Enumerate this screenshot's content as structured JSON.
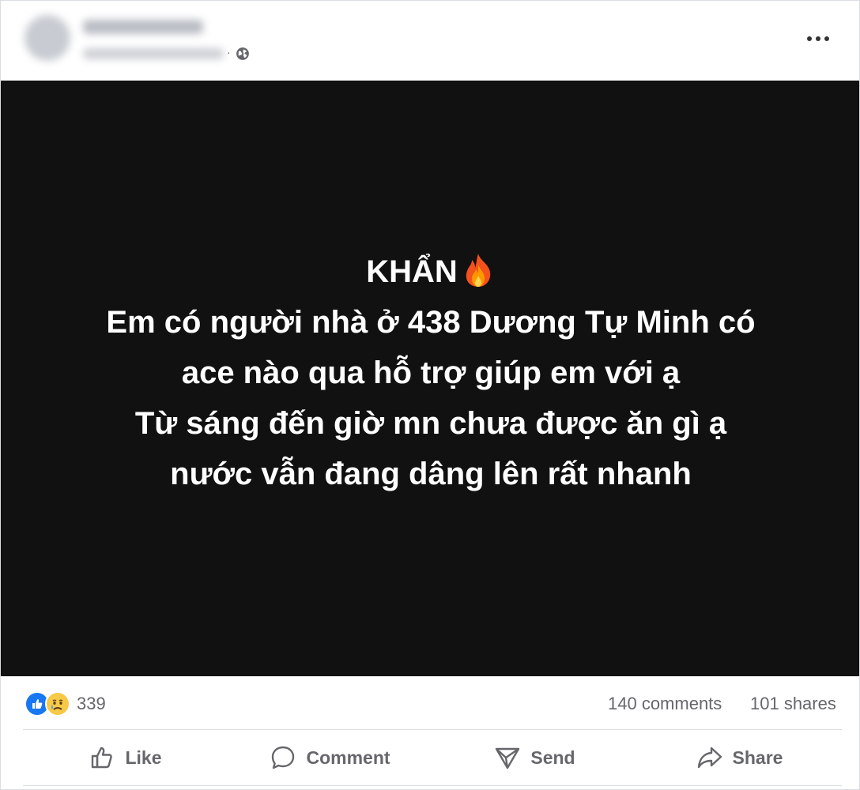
{
  "post": {
    "privacy_separator": "·",
    "icons": {
      "privacy": "globe-icon",
      "more": "more-options-icon"
    },
    "content_lines": [
      "KHẨN",
      "Em có người nhà ở 438 Dương Tự Minh có",
      "ace nào qua hỗ trợ giúp em với ạ",
      "Từ sáng đến giờ mn chưa được ăn gì ạ",
      "nước vẫn đang dâng lên rất nhanh"
    ],
    "background_color": "#111111"
  },
  "stats": {
    "reaction_count": "339",
    "reaction_icons": [
      "like-reaction-icon",
      "sad-reaction-icon"
    ],
    "comments_text": "140 comments",
    "shares_text": "101 shares"
  },
  "actions": {
    "like": "Like",
    "comment": "Comment",
    "send": "Send",
    "share": "Share"
  },
  "colors": {
    "like_blue": "#1877f2",
    "secondary_text": "#65676b",
    "divider": "#dadde1"
  }
}
